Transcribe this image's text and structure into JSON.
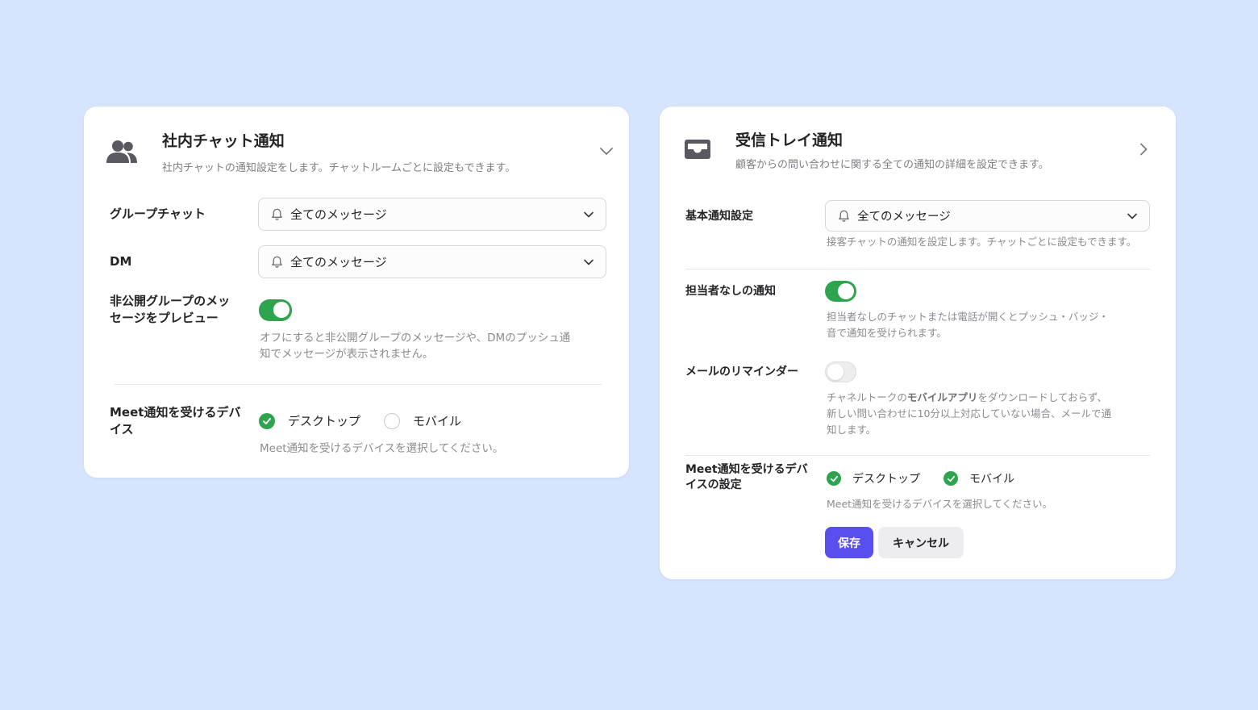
{
  "internal_chat": {
    "title": "社内チャット通知",
    "description": "社内チャットの通知設定をします。チャットルームごとに設定もできます。",
    "group_chat": {
      "label": "グループチャット",
      "value": "全てのメッセージ"
    },
    "dm": {
      "label": "DM",
      "value": "全てのメッセージ"
    },
    "private_preview": {
      "label_line1": "非公開グループのメッ",
      "label_line2": "セージをプレビュー",
      "enabled": true,
      "help_line1": "オフにすると非公開グループのメッセージや、DMのプッシュ通",
      "help_line2": "知でメッセージが表示されません。"
    },
    "meet_devices": {
      "label_line1": "Meet通知を受けるデバ",
      "label_line2": "イス",
      "options": [
        {
          "label": "デスクトップ",
          "checked": true
        },
        {
          "label": "モバイル",
          "checked": false
        }
      ],
      "help": "Meet通知を受けるデバイスを選択してください。"
    }
  },
  "inbox": {
    "title": "受信トレイ通知",
    "description": "顧客からの問い合わせに関する全ての通知の詳細を設定できます。",
    "basic": {
      "label": "基本通知設定",
      "value": "全てのメッセージ",
      "help": "接客チャットの通知を設定します。チャットごとに設定もできます。"
    },
    "unassigned": {
      "label": "担当者なしの通知",
      "enabled": true,
      "help_line1": "担当者なしのチャットまたは電話が開くとプッシュ・バッジ・",
      "help_line2": "音で通知を受けられます。"
    },
    "email_reminder": {
      "label": "メールのリマインダー",
      "enabled": false,
      "help_pre": "チャネルトークの",
      "help_emph": "モバイルアプリ",
      "help_post": "をダウンロードしておらず、",
      "help_line2": "新しい問い合わせに10分以上対応していない場合、メールで通",
      "help_line3": "知します。"
    },
    "meet_devices": {
      "label_line1": "Meet通知を受けるデバ",
      "label_line2": "イスの設定",
      "options": [
        {
          "label": "デスクトップ",
          "checked": true
        },
        {
          "label": "モバイル",
          "checked": true
        }
      ],
      "help": "Meet通知を受けるデバイスを選択してください。"
    },
    "save_label": "保存",
    "cancel_label": "キャンセル"
  },
  "colors": {
    "background": "#d6e4fe",
    "toggle_on": "#2ea44f",
    "primary_button": "#5b4ef0"
  }
}
